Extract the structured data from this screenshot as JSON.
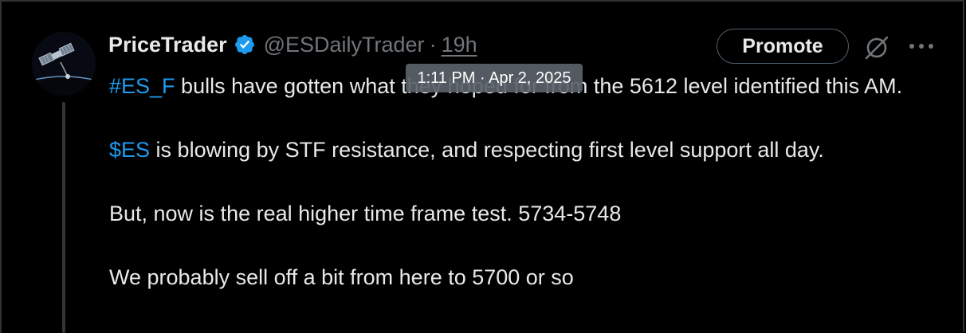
{
  "author": {
    "display_name": "PriceTrader",
    "handle": "@ESDailyTrader",
    "separator": "·",
    "relative_time": "19h",
    "verified": true,
    "verified_color": "#1d9bf0"
  },
  "tooltip": {
    "timestamp": "1:11 PM · Apr 2, 2025"
  },
  "actions": {
    "promote_label": "Promote",
    "grok_icon": "grok-icon",
    "more_icon": "more-icon"
  },
  "post": {
    "paragraphs": [
      {
        "tag": "#ES_F",
        "text_a": " bulls have gotten wh",
        "text_b": "at they hoped for",
        "text_c": " from the 5612 level identified this AM."
      },
      {
        "tag": "$ES",
        "text": " is blowing by STF resistance, and respecting first level support all day."
      },
      {
        "text": "But, now is the real higher time frame test. 5734-5748"
      },
      {
        "text": "We probably sell off a bit from here to 5700 or so"
      }
    ]
  },
  "colors": {
    "background": "#000000",
    "text_primary": "#e7e9ea",
    "text_secondary": "#71767b",
    "link": "#1d9bf0",
    "border": "#2f3336"
  }
}
